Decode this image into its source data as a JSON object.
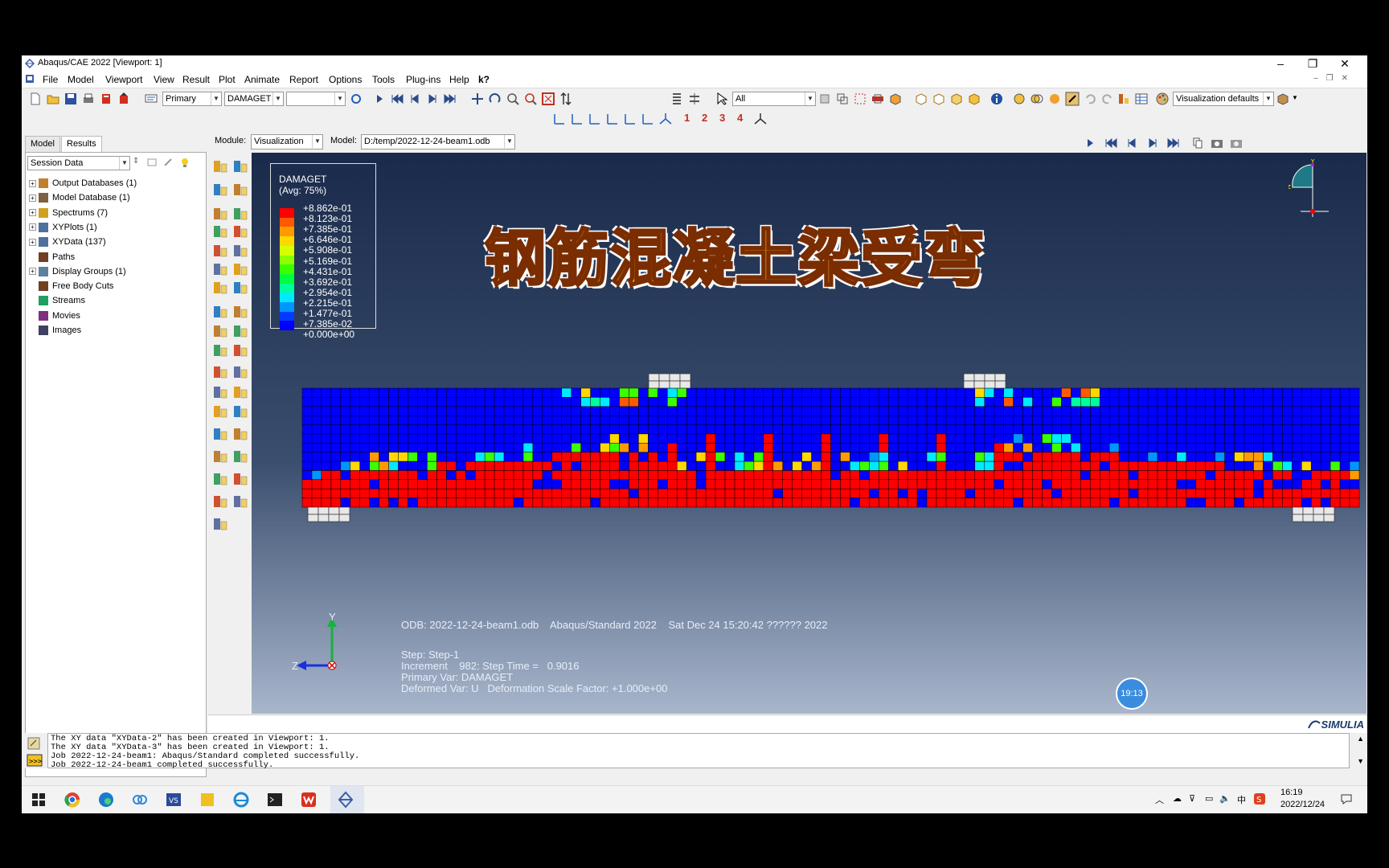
{
  "window": {
    "title": "Abaqus/CAE 2022 [Viewport: 1]",
    "min": "–",
    "restore": "❐",
    "close": "✕"
  },
  "menu": [
    "File",
    "Model",
    "Viewport",
    "View",
    "Result",
    "Plot",
    "Animate",
    "Report",
    "Options",
    "Tools",
    "Plug-ins",
    "Help",
    "k?"
  ],
  "toolbar": {
    "primary": "Primary",
    "variable": "DAMAGET",
    "selection_filter": "All",
    "vis_defaults": "Visualization defaults"
  },
  "toolbar2_digits": [
    "1",
    "2",
    "3",
    "4"
  ],
  "module_bar": {
    "module_label": "Module:",
    "module_value": "Visualization",
    "model_label": "Model:",
    "model_value": "D:/temp/2022-12-24-beam1.odb"
  },
  "tabs": [
    "Model",
    "Results"
  ],
  "tree": {
    "filter": "Session Data",
    "items": [
      {
        "label": "Output Databases (1)",
        "exp": true
      },
      {
        "label": "Model Database (1)",
        "exp": true
      },
      {
        "label": "Spectrums (7)",
        "exp": true
      },
      {
        "label": "XYPlots (1)",
        "exp": true
      },
      {
        "label": "XYData (137)",
        "exp": true
      },
      {
        "label": "Paths",
        "exp": false
      },
      {
        "label": "Display Groups (1)",
        "exp": true
      },
      {
        "label": "Free Body Cuts",
        "exp": false
      },
      {
        "label": "Streams",
        "exp": false
      },
      {
        "label": "Movies",
        "exp": false
      },
      {
        "label": "Images",
        "exp": false
      }
    ]
  },
  "legend": {
    "title1": "DAMAGET",
    "title2": "(Avg: 75%)",
    "values": [
      "+8.862e-01",
      "+8.123e-01",
      "+7.385e-01",
      "+6.646e-01",
      "+5.908e-01",
      "+5.169e-01",
      "+4.431e-01",
      "+3.692e-01",
      "+2.954e-01",
      "+2.215e-01",
      "+1.477e-01",
      "+7.385e-02",
      "+0.000e+00"
    ],
    "colors": [
      "#ff0000",
      "#ff5a00",
      "#ff9b00",
      "#ffd800",
      "#d6ff00",
      "#8cff00",
      "#3cff00",
      "#00ff3c",
      "#00ff9b",
      "#00eaff",
      "#0096ff",
      "#003cff",
      "#0000ff"
    ]
  },
  "overlay_title": "钢筋混凝土梁受弯",
  "odb_info": {
    "line1": "ODB: 2022-12-24-beam1.odb    Abaqus/Standard 2022    Sat Dec 24 15:20:42 ?????? 2022",
    "step": "Step: Step-1",
    "increment": "Increment    982: Step Time =   0.9016",
    "primary": "Primary Var: DAMAGET",
    "deformed": "Deformed Var: U   Deformation Scale Factor: +1.000e+00"
  },
  "triad": {
    "y": "Y",
    "z": "Z"
  },
  "badge": "19:13",
  "brand": "SIMULIA",
  "messages": [
    "The XY data \"XYData-2\" has been created in Viewport: 1.",
    "The XY data \"XYData-3\" has been created in Viewport: 1.",
    "Job 2022-12-24-beam1: Abaqus/Standard completed successfully.",
    "Job 2022-12-24-beam1 completed successfully."
  ],
  "clock": {
    "time": "16:19",
    "date": "2022/12/24"
  },
  "tray_text": "中",
  "colors": {
    "accent": "#f8a21c",
    "mesh_blue": "#0000ff",
    "mesh_red": "#ff0000"
  }
}
